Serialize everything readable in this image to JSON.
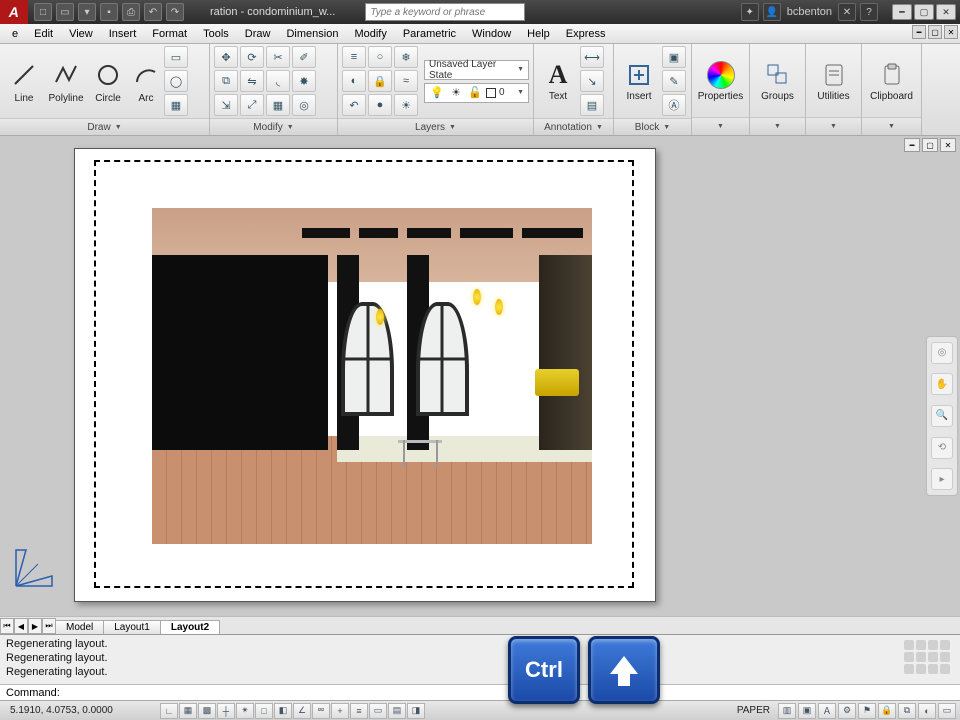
{
  "title": "ration - condominium_w...",
  "search_placeholder": "Type a keyword or phrase",
  "user": "bcbenton",
  "menu": [
    "e",
    "Edit",
    "View",
    "Insert",
    "Format",
    "Tools",
    "Draw",
    "Dimension",
    "Modify",
    "Parametric",
    "Window",
    "Help",
    "Express"
  ],
  "ribbon": {
    "draw": {
      "title": "Draw",
      "tools": [
        "Line",
        "Polyline",
        "Circle",
        "Arc"
      ]
    },
    "modify": {
      "title": "Modify"
    },
    "layers": {
      "title": "Layers",
      "state": "Unsaved Layer State",
      "current": "0"
    },
    "annotation": {
      "title": "Annotation",
      "text": "Text"
    },
    "block": {
      "title": "Block",
      "insert": "Insert"
    },
    "properties": {
      "title": "Properties"
    },
    "groups": {
      "title": "Groups"
    },
    "utilities": {
      "title": "Utilities"
    },
    "clipboard": {
      "title": "Clipboard"
    }
  },
  "tabs": {
    "model": "Model",
    "layout1": "Layout1",
    "layout2": "Layout2"
  },
  "command": {
    "history": [
      "Regenerating layout.",
      "Regenerating layout.",
      "Regenerating layout."
    ],
    "prompt": "Command:"
  },
  "keys": {
    "ctrl": "Ctrl"
  },
  "status": {
    "coords": "5.1910, 4.0753, 0.0000",
    "space": "PAPER"
  }
}
